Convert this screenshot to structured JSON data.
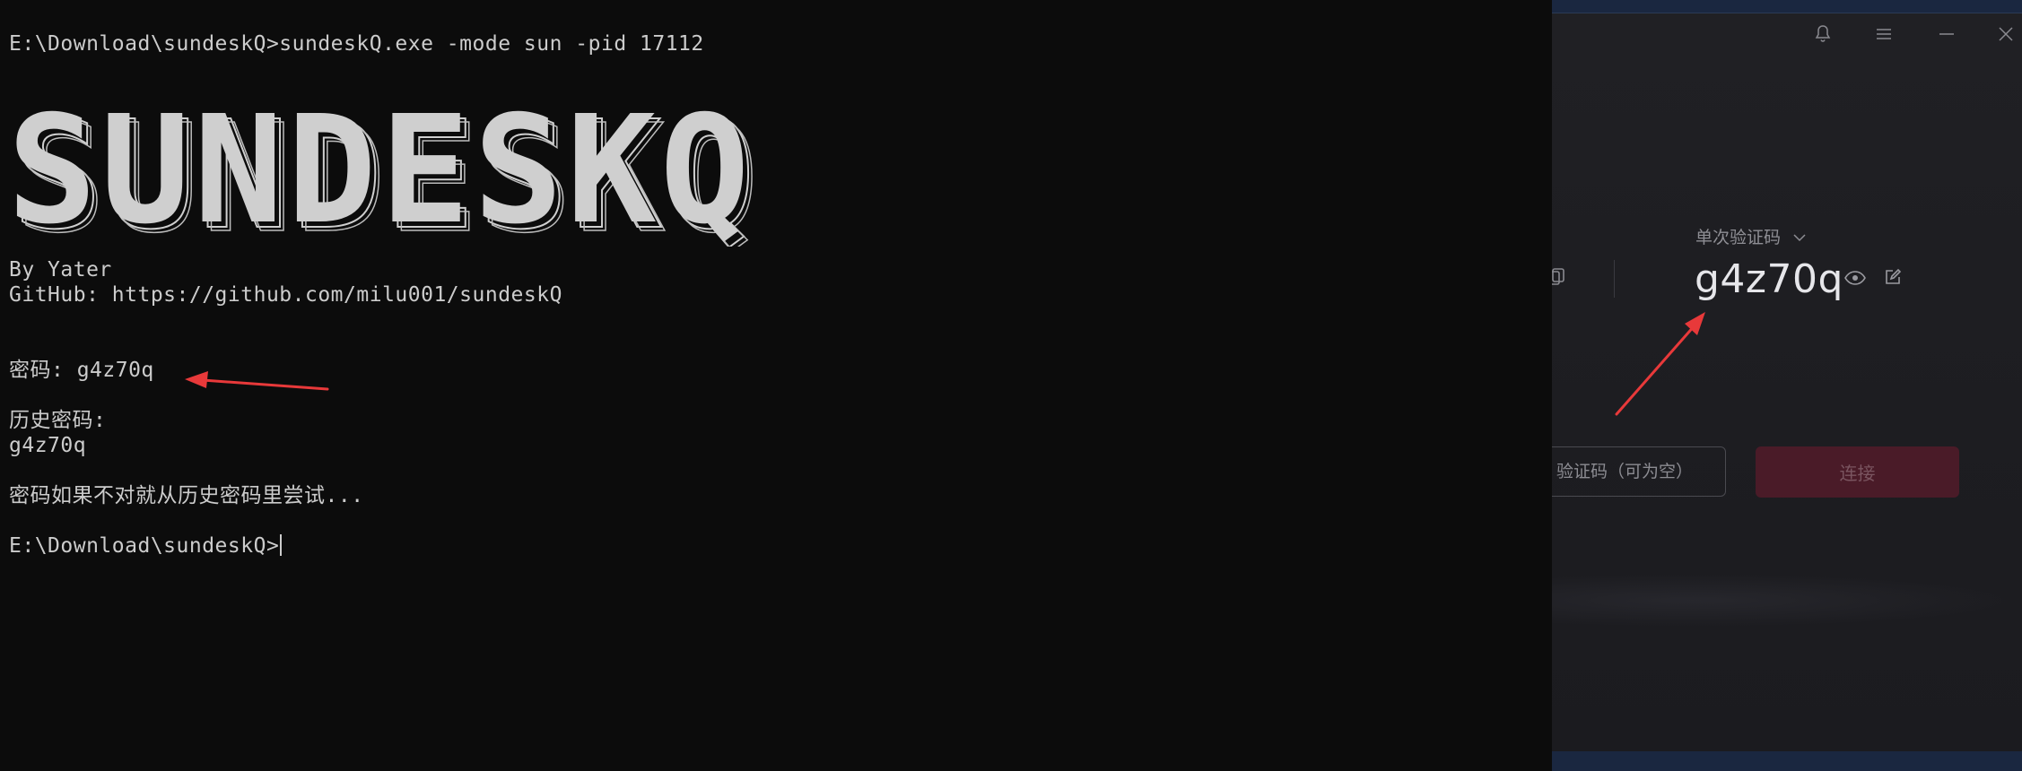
{
  "terminal": {
    "command_line": "E:\\Download\\sundeskQ>sundeskQ.exe -mode sun -pid 17112",
    "banner_text": "SUNDESKQ",
    "author_line": "By Yater",
    "github_line": "GitHub: https://github.com/milu001/sundeskQ",
    "password_line": "密码: g4z70q",
    "history_title": "历史密码:",
    "history_value": "g4z70q",
    "hint_line": "密码如果不对就从历史密码里尝试...",
    "prompt_line": "E:\\Download\\sundeskQ>"
  },
  "remote_app": {
    "controls": [
      "bell-icon",
      "menu-icon",
      "minimize-icon",
      "close-icon"
    ],
    "code_label": "单次验证码",
    "code_label_icon": "chevron-down-icon",
    "code_value": "g4z70q",
    "password_placeholder": "验证码（可为空）",
    "connect_label": "连接",
    "accent_color": "#4a1b28"
  },
  "annotations": {
    "arrow_color": "#e8393a"
  }
}
